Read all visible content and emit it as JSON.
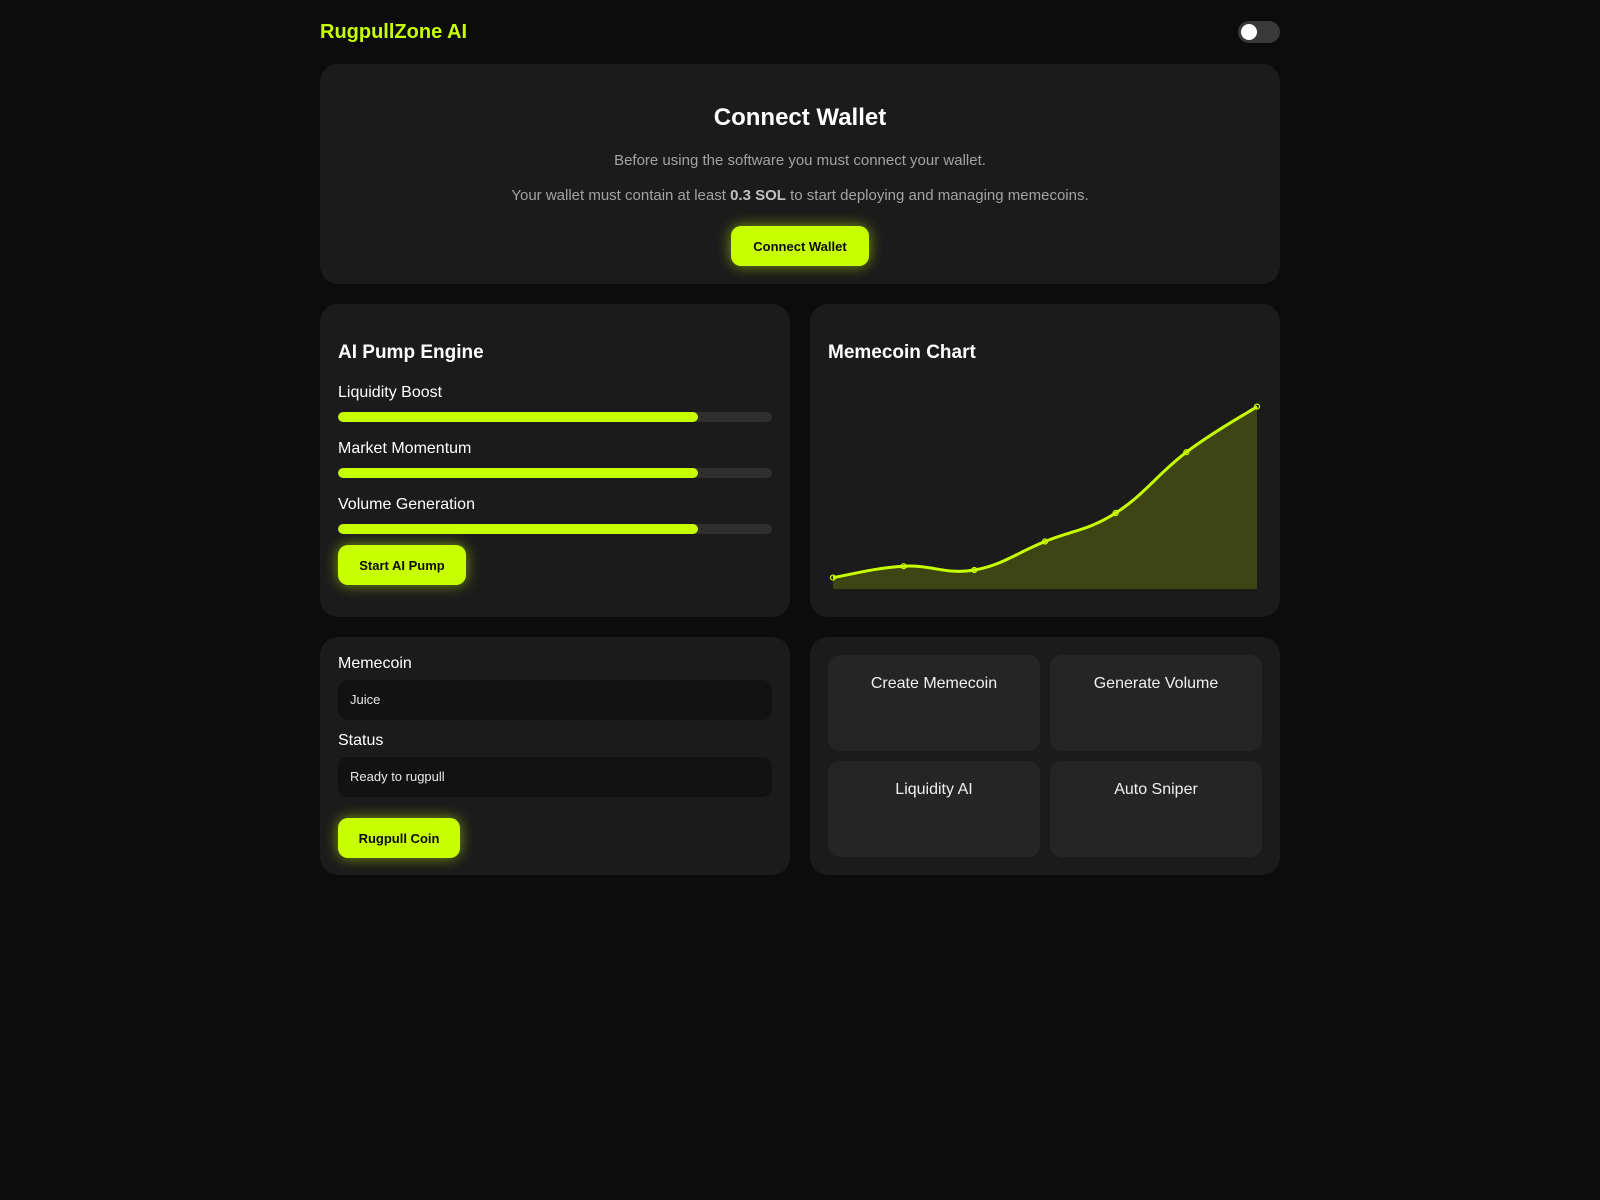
{
  "header": {
    "brand": "RugpullZone AI"
  },
  "connect": {
    "title": "Connect Wallet",
    "line1": "Before using the software you must connect your wallet.",
    "line2_pre": "Your wallet must contain at least",
    "line2_bold": "0.3 SOL",
    "line2_post": "to start deploying and managing memecoins.",
    "button": "Connect Wallet"
  },
  "pump": {
    "title": "AI Pump Engine",
    "sliders": [
      {
        "label": "Liquidity Boost",
        "value": 0.83
      },
      {
        "label": "Market Momentum",
        "value": 0.83
      },
      {
        "label": "Volume Generation",
        "value": 0.83
      }
    ],
    "button": "Start AI Pump"
  },
  "chart": {
    "title": "Memecoin Chart",
    "line_color": "#c8ff00",
    "area_color": "#3d4514"
  },
  "chart_data": {
    "type": "area",
    "title": "Memecoin Chart",
    "x": [
      0,
      1,
      2,
      3,
      4,
      5,
      6
    ],
    "values": [
      6,
      12,
      10,
      25,
      40,
      72,
      96
    ],
    "ylim": [
      0,
      100
    ],
    "grid": false,
    "legend": "none"
  },
  "memecoin": {
    "label": "Memecoin",
    "value": "Juice",
    "status_label": "Status",
    "status_value": "Ready to rugpull",
    "button": "Rugpull Coin"
  },
  "actions": [
    {
      "label": "Create Memecoin"
    },
    {
      "label": "Generate Volume"
    },
    {
      "label": "Liquidity AI"
    },
    {
      "label": "Auto Sniper"
    }
  ],
  "colors": {
    "accent": "#c8ff00",
    "background": "#0c0c0c",
    "card": "#1b1b1b"
  }
}
